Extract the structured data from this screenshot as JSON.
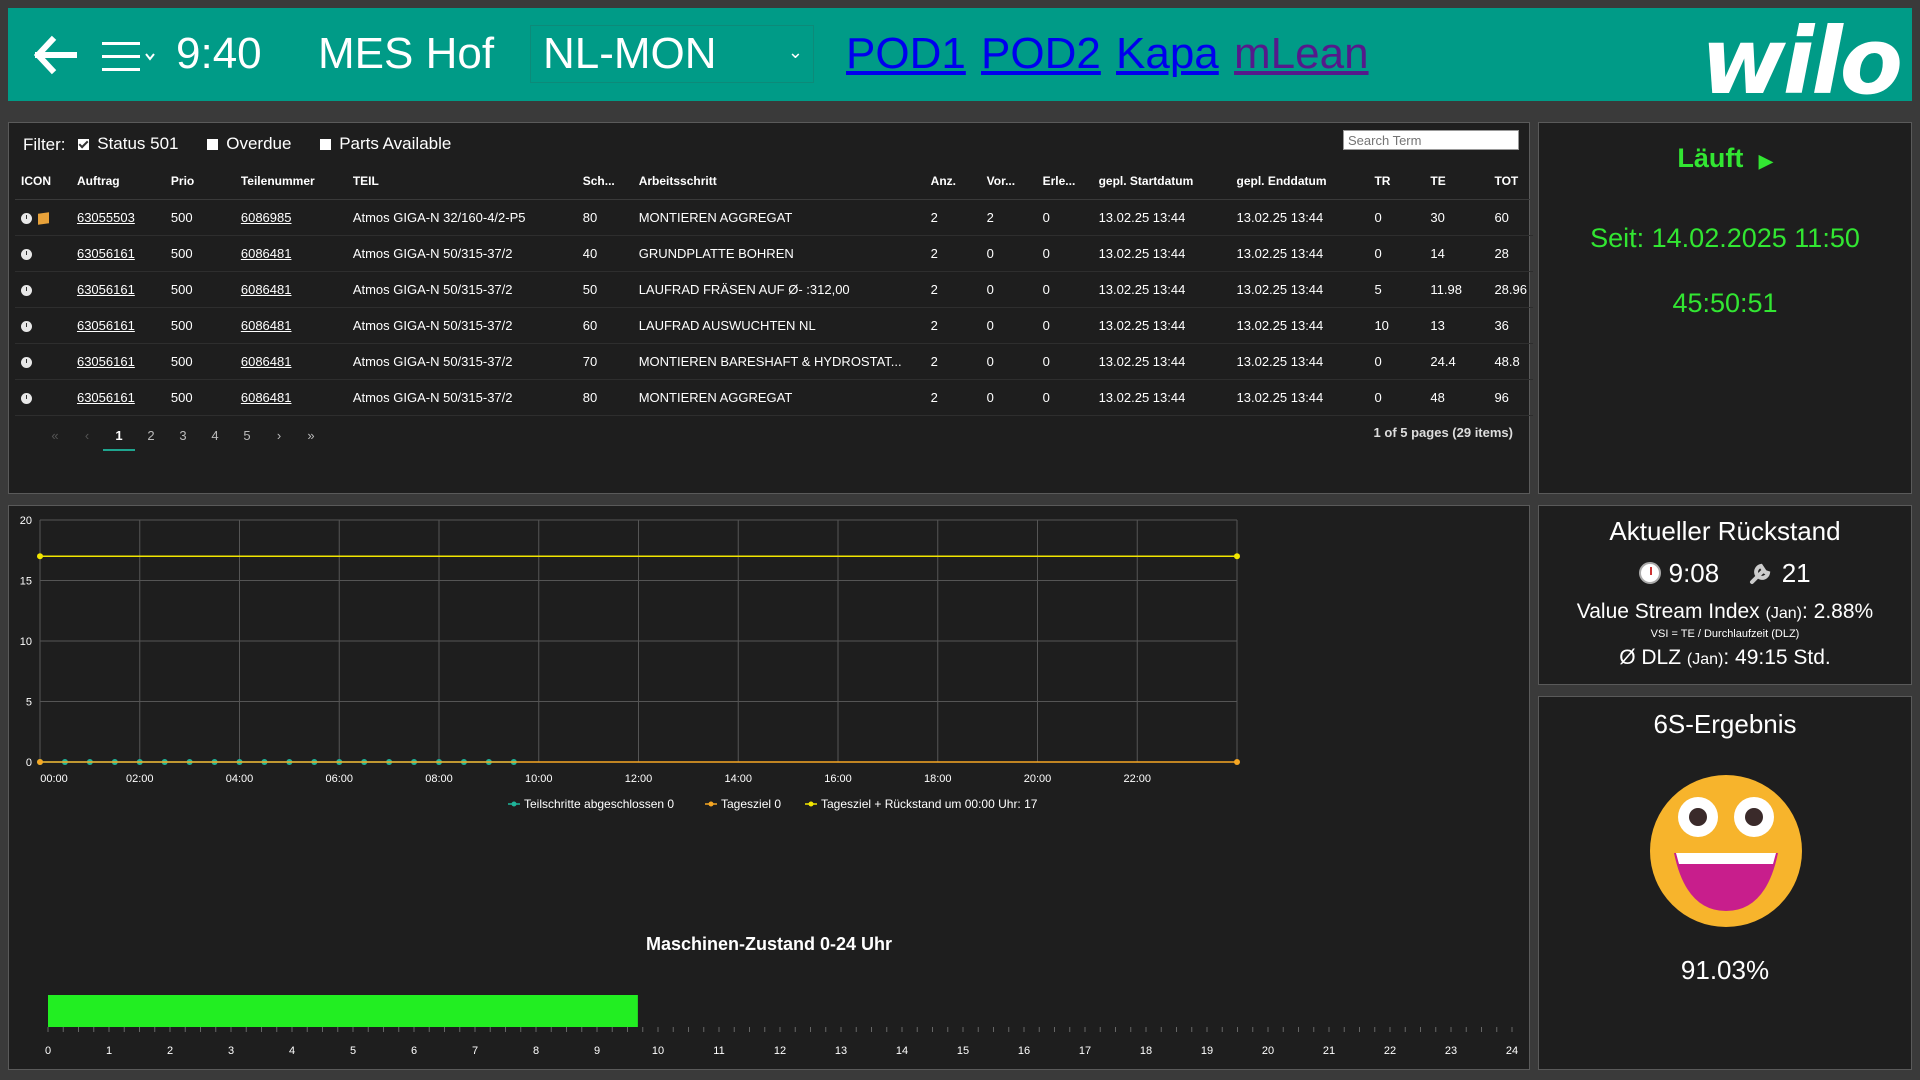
{
  "header": {
    "time": "9:40",
    "app_title": "MES Hof",
    "line_select": "NL-MON",
    "links": [
      "POD1",
      "POD2",
      "Kapa",
      "mLean"
    ],
    "link_colors": [
      "#0000ee",
      "#0000ee",
      "#0000ee",
      "#551a8b"
    ],
    "logo": "wilo"
  },
  "filter": {
    "label": "Filter:",
    "options": [
      {
        "label": "Status 501",
        "checked": true
      },
      {
        "label": "Overdue",
        "checked": false
      },
      {
        "label": "Parts Available",
        "checked": false
      }
    ],
    "search_placeholder": "Search Term"
  },
  "table": {
    "columns": [
      "ICON",
      "Auftrag",
      "Prio",
      "Teilenummer",
      "TEIL",
      "Sch...",
      "Arbeitsschritt",
      "Anz.",
      "Vor...",
      "Erle...",
      "gepl. Startdatum",
      "gepl. Enddatum",
      "TR",
      "TE",
      "TOT"
    ],
    "rows": [
      {
        "icons": [
          "clock-icon",
          "package-icon"
        ],
        "auftrag": "63055503",
        "prio": "500",
        "teilenummer": "6086985",
        "teil": "Atmos GIGA-N 32/160-4/2-P5",
        "sch": "80",
        "arbeitsschritt": "MONTIEREN AGGREGAT",
        "anz": "2",
        "vor": "2",
        "erle": "0",
        "start": "13.02.25 13:44",
        "ende": "13.02.25 13:44",
        "tr": "0",
        "te": "30",
        "tot": "60"
      },
      {
        "icons": [
          "clock-icon"
        ],
        "auftrag": "63056161",
        "prio": "500",
        "teilenummer": "6086481",
        "teil": "Atmos GIGA-N 50/315-37/2",
        "sch": "40",
        "arbeitsschritt": "GRUNDPLATTE BOHREN",
        "anz": "2",
        "vor": "0",
        "erle": "0",
        "start": "13.02.25 13:44",
        "ende": "13.02.25 13:44",
        "tr": "0",
        "te": "14",
        "tot": "28"
      },
      {
        "icons": [
          "clock-icon"
        ],
        "auftrag": "63056161",
        "prio": "500",
        "teilenummer": "6086481",
        "teil": "Atmos GIGA-N 50/315-37/2",
        "sch": "50",
        "arbeitsschritt": "LAUFRAD FRÄSEN AUF Ø- :312,00",
        "anz": "2",
        "vor": "0",
        "erle": "0",
        "start": "13.02.25 13:44",
        "ende": "13.02.25 13:44",
        "tr": "5",
        "te": "11.98",
        "tot": "28.96"
      },
      {
        "icons": [
          "clock-icon"
        ],
        "auftrag": "63056161",
        "prio": "500",
        "teilenummer": "6086481",
        "teil": "Atmos GIGA-N 50/315-37/2",
        "sch": "60",
        "arbeitsschritt": "LAUFRAD AUSWUCHTEN NL",
        "anz": "2",
        "vor": "0",
        "erle": "0",
        "start": "13.02.25 13:44",
        "ende": "13.02.25 13:44",
        "tr": "10",
        "te": "13",
        "tot": "36"
      },
      {
        "icons": [
          "clock-icon"
        ],
        "auftrag": "63056161",
        "prio": "500",
        "teilenummer": "6086481",
        "teil": "Atmos GIGA-N 50/315-37/2",
        "sch": "70",
        "arbeitsschritt": "MONTIEREN BARESHAFT & HYDROSTAT...",
        "anz": "2",
        "vor": "0",
        "erle": "0",
        "start": "13.02.25 13:44",
        "ende": "13.02.25 13:44",
        "tr": "0",
        "te": "24.4",
        "tot": "48.8"
      },
      {
        "icons": [
          "clock-icon"
        ],
        "auftrag": "63056161",
        "prio": "500",
        "teilenummer": "6086481",
        "teil": "Atmos GIGA-N 50/315-37/2",
        "sch": "80",
        "arbeitsschritt": "MONTIEREN AGGREGAT",
        "anz": "2",
        "vor": "0",
        "erle": "0",
        "start": "13.02.25 13:44",
        "ende": "13.02.25 13:44",
        "tr": "0",
        "te": "48",
        "tot": "96"
      }
    ],
    "pager": {
      "pages": [
        "1",
        "2",
        "3",
        "4",
        "5"
      ],
      "active": "1",
      "info": "1 of 5 pages (29 items)"
    }
  },
  "status": {
    "label": "Läuft",
    "since": "Seit: 14.02.2025 11:50",
    "duration": "45:50:51",
    "color": "#32e632"
  },
  "backlog": {
    "title": "Aktueller Rückstand",
    "time_value": "9:08",
    "tool_value": "21",
    "vsi_label": "Value Stream Index",
    "vsi_period": "(Jan)",
    "vsi_value": ": 2.88%",
    "vsi_note": "VSI = TE / Durchlaufzeit (DLZ)",
    "dlz_label": "Ø DLZ",
    "dlz_period": "(Jan)",
    "dlz_value": ": 49:15 Std."
  },
  "six_s": {
    "title": "6S-Ergebnis",
    "value": "91.03%"
  },
  "chart_data": [
    {
      "type": "line",
      "x_ticks": [
        "00:00",
        "02:00",
        "04:00",
        "06:00",
        "08:00",
        "10:00",
        "12:00",
        "14:00",
        "16:00",
        "18:00",
        "20:00",
        "22:00"
      ],
      "xlim": [
        0,
        24
      ],
      "ylim": [
        0,
        20
      ],
      "y_ticks": [
        0,
        5,
        10,
        15,
        20
      ],
      "grid": true,
      "legend_position": "bottom",
      "series": [
        {
          "name": "Teilschritte abgeschlossen 0",
          "color": "#1fb59a",
          "x": [
            0,
            0.5,
            1,
            1.5,
            2,
            2.5,
            3,
            3.5,
            4,
            4.5,
            5,
            5.5,
            6,
            6.5,
            7,
            7.5,
            8,
            8.5,
            9,
            9.5
          ],
          "y": [
            0,
            0,
            0,
            0,
            0,
            0,
            0,
            0,
            0,
            0,
            0,
            0,
            0,
            0,
            0,
            0,
            0,
            0,
            0,
            0
          ]
        },
        {
          "name": "Tagesziel 0",
          "color": "#f5a623",
          "x": [
            0,
            24
          ],
          "y": [
            0,
            0
          ]
        },
        {
          "name": "Tagesziel + Rückstand um 00:00 Uhr: 17",
          "color": "#f2e600",
          "x": [
            0,
            24
          ],
          "y": [
            17,
            17
          ]
        }
      ]
    },
    {
      "type": "bar",
      "title": "Maschinen-Zustand 0-24 Uhr",
      "x_ticks": [
        "0",
        "1",
        "2",
        "3",
        "4",
        "5",
        "6",
        "7",
        "8",
        "9",
        "10",
        "11",
        "12",
        "13",
        "14",
        "15",
        "16",
        "17",
        "18",
        "19",
        "20",
        "21",
        "22",
        "23",
        "24"
      ],
      "xlim": [
        0,
        24
      ],
      "segments": [
        {
          "start": 0,
          "end": 9.67,
          "color": "#22ee22"
        }
      ]
    }
  ]
}
